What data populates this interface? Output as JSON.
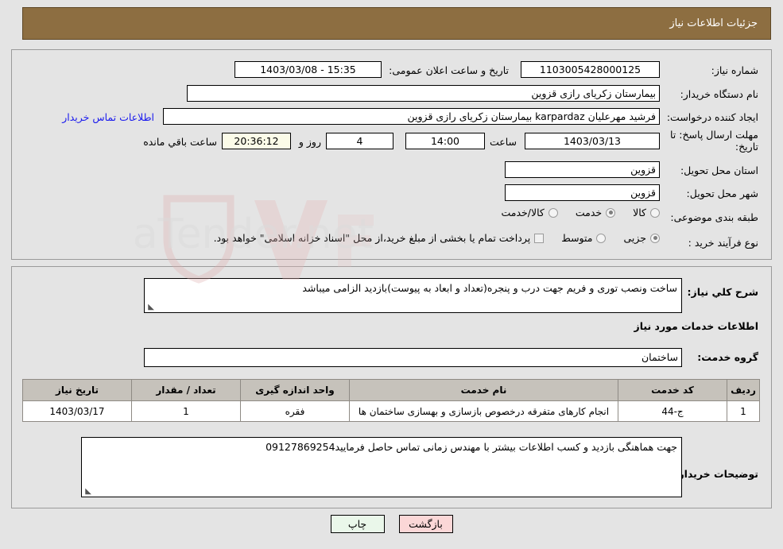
{
  "header": {
    "title": "جزئیات اطلاعات نیاز"
  },
  "form": {
    "need_number": {
      "label": "شماره نیاز:",
      "value": "1103005428000125"
    },
    "announce_datetime": {
      "label": "تاریخ و ساعت اعلان عمومی:",
      "value": "15:35 - 1403/03/08"
    },
    "buyer_org": {
      "label": "نام دستگاه خریدار:",
      "value": "بیمارستان زکریای رازی قزوین"
    },
    "request_creator": {
      "label": "ایجاد کننده درخواست:",
      "value": "فرشید مهرعلیان karpardaz بیمارستان زکریای رازی قزوین"
    },
    "buyer_contact_link": "اطلاعات تماس خریدار",
    "deadline": {
      "label": "مهلت ارسال پاسخ: تا تاریخ:",
      "date": "1403/03/13",
      "hour_label": "ساعت",
      "hour_value": "14:00",
      "days_value": "4",
      "days_label": "روز و",
      "timer_value": "20:36:12",
      "remaining_label": "ساعت باقي مانده"
    },
    "delivery_province": {
      "label": "استان محل تحویل:",
      "value": "قزوین"
    },
    "delivery_city": {
      "label": "شهر محل تحویل:",
      "value": "قزوین"
    },
    "category": {
      "label": "طبقه بندی موضوعی:",
      "options": [
        {
          "label": "کالا",
          "selected": false
        },
        {
          "label": "خدمت",
          "selected": true
        },
        {
          "label": "کالا/خدمت",
          "selected": false
        }
      ]
    },
    "purchase_process": {
      "label": "نوع فرآیند خرید :",
      "options": [
        {
          "label": "جزیی",
          "selected": true
        },
        {
          "label": "متوسط",
          "selected": false
        }
      ],
      "treasury_checkbox_checked": false,
      "treasury_note": "پرداخت تمام یا بخشی از مبلغ خرید،از محل \"اسناد خزانه اسلامی\" خواهد بود."
    },
    "general_description": {
      "label": "شرح کلي نیاز:",
      "value": "ساخت ونصب توری و فریم جهت درب و پنجره(تعداد و ابعاد به پیوست)بازدید الزامی میباشد"
    },
    "services_section_title": "اطلاعات خدمات مورد نیاز",
    "service_group": {
      "label": "گروه خدمت:",
      "value": "ساختمان"
    },
    "buyer_notes": {
      "label": "توضیحات خریدار:",
      "value": "جهت هماهنگی بازدید و کسب اطلاعات بیشتر با مهندس زمانی تماس حاصل فرمایید09127869254"
    }
  },
  "table": {
    "headers": [
      "ردیف",
      "کد خدمت",
      "نام خدمت",
      "واحد اندازه گیری",
      "تعداد / مقدار",
      "تاریخ نیاز"
    ],
    "rows": [
      {
        "row_no": "1",
        "service_code": "ج-44",
        "service_name": "انجام کارهای متفرقه درخصوص بازسازی و بهسازی ساختمان ها",
        "unit": "فقره",
        "quantity": "1",
        "need_date": "1403/03/17"
      }
    ]
  },
  "buttons": {
    "print": "چاپ",
    "back": "بازگشت"
  },
  "colors": {
    "header_bg": "#8d6e41",
    "page_bg": "#e4e4e4",
    "link": "#1a1aee",
    "timer_bg": "#fbfbe8",
    "table_header_bg": "#c6c2bb",
    "print_btn": "#eaf7ea",
    "back_btn": "#fbd7d7"
  }
}
